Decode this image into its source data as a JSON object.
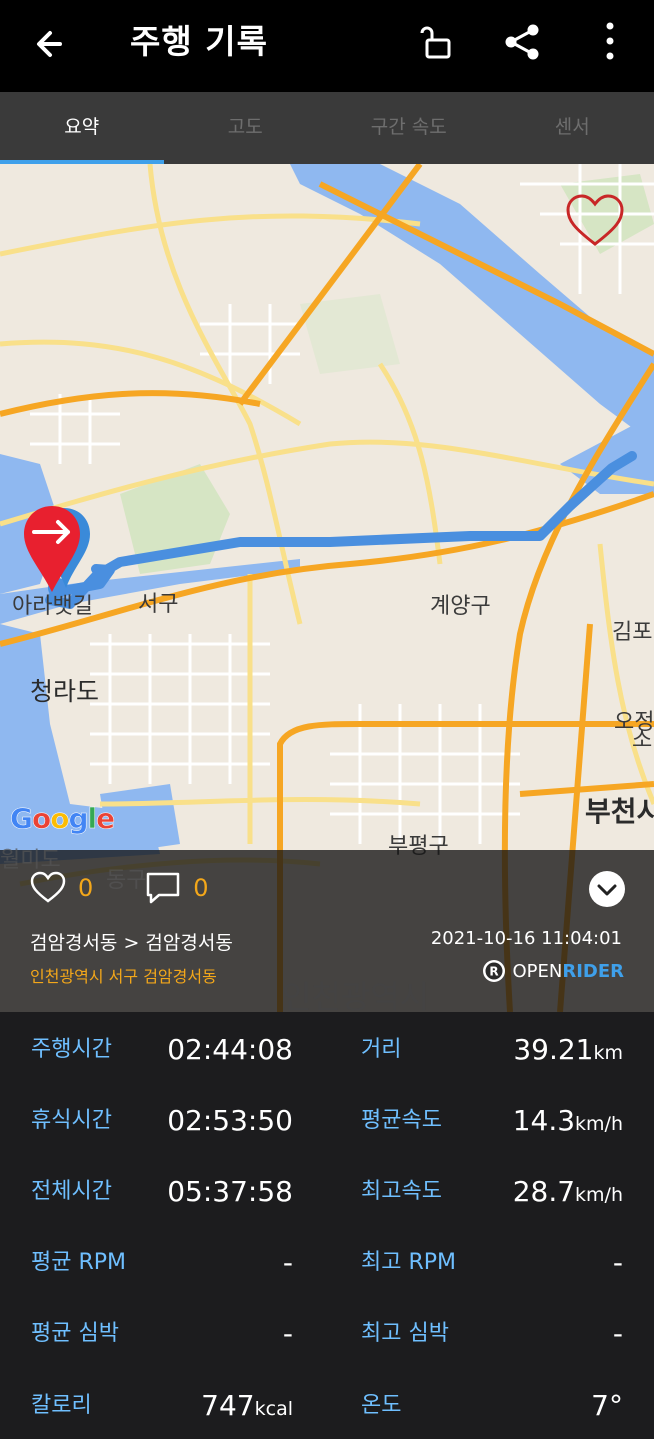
{
  "header": {
    "title": "주행 기록",
    "icons": [
      "back-arrow-icon",
      "unlock-icon",
      "share-icon",
      "more-vert-icon"
    ]
  },
  "tabs": [
    {
      "label": "요약",
      "active": true
    },
    {
      "label": "고도",
      "active": false
    },
    {
      "label": "구간 속도",
      "active": false
    },
    {
      "label": "센서",
      "active": false
    }
  ],
  "map": {
    "labels": {
      "arabeu": "아라뱃길",
      "seogu": "서구",
      "gyeyang": "계양구",
      "gimpo": "김포",
      "cheongna": "청라도",
      "ojeong": "오정",
      "bucheon": "부천시",
      "bupyeong": "부평구",
      "donggu": "동구",
      "wolmido": "월미도",
      "incheon": "인천광역시",
      "so": "소"
    },
    "google_logo": "Google",
    "colors": {
      "route": "#4a8fdf",
      "road_major": "#f6a623",
      "road_minor": "#f9e08a",
      "water": "#8fb8f0",
      "land": "#efe9df"
    }
  },
  "summary": {
    "likes": "0",
    "comments": "0",
    "route": "검암경서동 > 검암경서동",
    "address": "인천광역시 서구 검암경서동",
    "datetime": "2021-10-16 11:04:01",
    "brand_open": "OPEN",
    "brand_rider": "RIDER"
  },
  "stats": {
    "ride_time_label": "주행시간",
    "ride_time": "02:44:08",
    "distance_label": "거리",
    "distance": "39.21",
    "distance_unit": "km",
    "rest_time_label": "휴식시간",
    "rest_time": "02:53:50",
    "avg_speed_label": "평균속도",
    "avg_speed": "14.3",
    "avg_speed_unit": "km/h",
    "total_time_label": "전체시간",
    "total_time": "05:37:58",
    "max_speed_label": "최고속도",
    "max_speed": "28.7",
    "max_speed_unit": "km/h",
    "avg_rpm_label": "평균 RPM",
    "avg_rpm": "-",
    "max_rpm_label": "최고 RPM",
    "max_rpm": "-",
    "avg_hr_label": "평균 심박",
    "avg_hr": "-",
    "max_hr_label": "최고 심박",
    "max_hr": "-",
    "calorie_label": "칼로리",
    "calorie": "747",
    "calorie_unit": "kcal",
    "temp_label": "온도",
    "temp": "7°"
  }
}
